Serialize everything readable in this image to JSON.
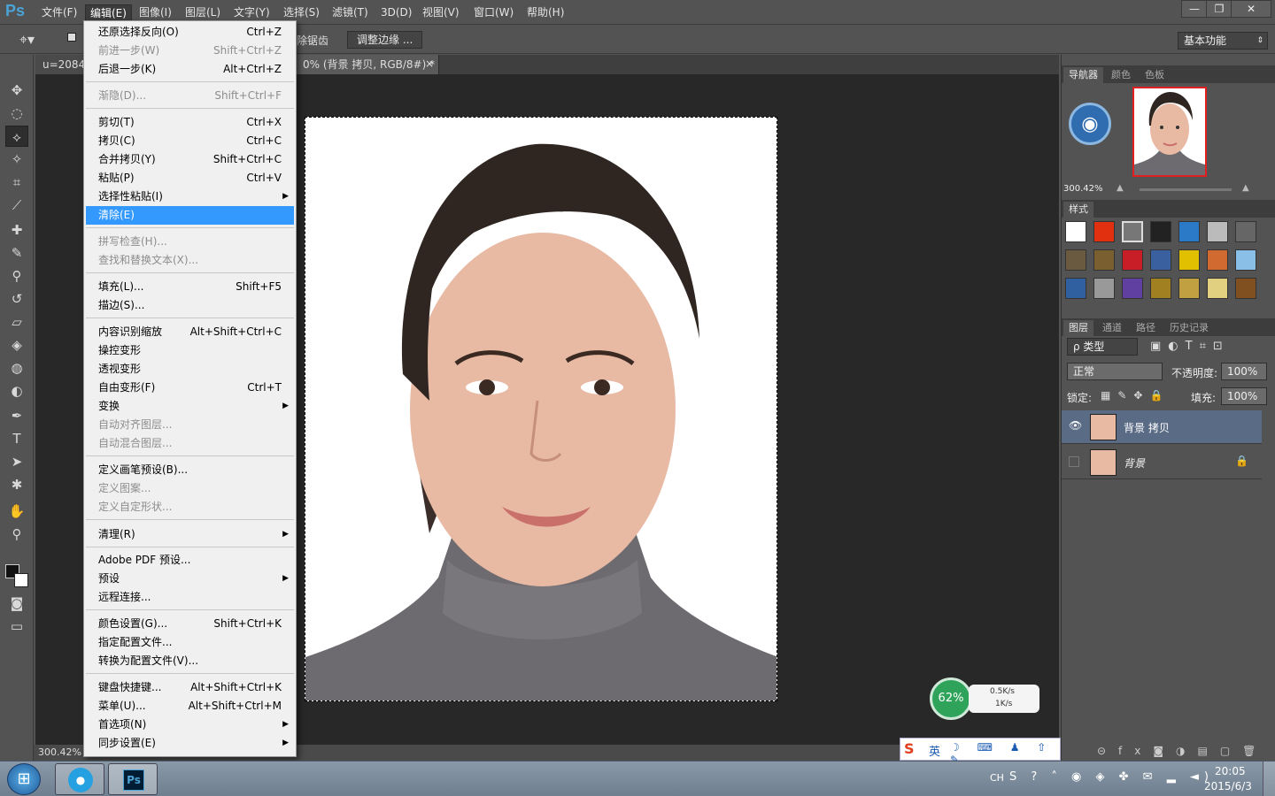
{
  "app": {
    "logo": "Ps",
    "menus": [
      "文件(F)",
      "编辑(E)",
      "图像(I)",
      "图层(L)",
      "文字(Y)",
      "选择(S)",
      "滤镜(T)",
      "3D(D)",
      "视图(V)",
      "窗口(W)",
      "帮助(H)"
    ],
    "window_buttons": [
      "—",
      "❐",
      "✕"
    ]
  },
  "options_bar": {
    "partial_label": "除锯齿",
    "refine_edge_button": "调整边缘 ...",
    "workspace": "基本功能"
  },
  "tabs": {
    "left_tab": "u=2084",
    "doc_tab": "0% (背景 拷贝, RGB/8#) *",
    "close": "×"
  },
  "status": {
    "zoom": "300.42%"
  },
  "edit_menu": {
    "items": [
      {
        "label": "还原选择反向(O)",
        "shortcut": "Ctrl+Z",
        "disabled": false
      },
      {
        "label": "前进一步(W)",
        "shortcut": "Shift+Ctrl+Z",
        "disabled": true
      },
      {
        "label": "后退一步(K)",
        "shortcut": "Alt+Ctrl+Z",
        "disabled": false
      },
      {
        "label": "渐隐(D)...",
        "shortcut": "Shift+Ctrl+F",
        "disabled": true
      },
      {
        "label": "剪切(T)",
        "shortcut": "Ctrl+X",
        "disabled": false
      },
      {
        "label": "拷贝(C)",
        "shortcut": "Ctrl+C",
        "disabled": false
      },
      {
        "label": "合并拷贝(Y)",
        "shortcut": "Shift+Ctrl+C",
        "disabled": false
      },
      {
        "label": "粘贴(P)",
        "shortcut": "Ctrl+V",
        "disabled": false
      },
      {
        "label": "选择性粘贴(I)",
        "shortcut": "",
        "submenu": true,
        "disabled": false
      },
      {
        "label": "清除(E)",
        "shortcut": "",
        "disabled": false,
        "highlighted": true
      },
      {
        "label": "拼写检查(H)...",
        "shortcut": "",
        "disabled": true
      },
      {
        "label": "查找和替换文本(X)...",
        "shortcut": "",
        "disabled": true
      },
      {
        "label": "填充(L)...",
        "shortcut": "Shift+F5",
        "disabled": false
      },
      {
        "label": "描边(S)...",
        "shortcut": "",
        "disabled": false
      },
      {
        "label": "内容识别缩放",
        "shortcut": "Alt+Shift+Ctrl+C",
        "disabled": false
      },
      {
        "label": "操控变形",
        "shortcut": "",
        "disabled": false
      },
      {
        "label": "透视变形",
        "shortcut": "",
        "disabled": false
      },
      {
        "label": "自由变形(F)",
        "shortcut": "Ctrl+T",
        "disabled": false
      },
      {
        "label": "变换",
        "shortcut": "",
        "submenu": true,
        "disabled": false
      },
      {
        "label": "自动对齐图层...",
        "shortcut": "",
        "disabled": true
      },
      {
        "label": "自动混合图层...",
        "shortcut": "",
        "disabled": true
      },
      {
        "label": "定义画笔预设(B)...",
        "shortcut": "",
        "disabled": false
      },
      {
        "label": "定义图案...",
        "shortcut": "",
        "disabled": true
      },
      {
        "label": "定义自定形状...",
        "shortcut": "",
        "disabled": true
      },
      {
        "label": "清理(R)",
        "shortcut": "",
        "submenu": true,
        "disabled": false
      },
      {
        "label": "Adobe PDF 预设...",
        "shortcut": "",
        "disabled": false
      },
      {
        "label": "预设",
        "shortcut": "",
        "submenu": true,
        "disabled": false
      },
      {
        "label": "远程连接...",
        "shortcut": "",
        "disabled": false
      },
      {
        "label": "颜色设置(G)...",
        "shortcut": "Shift+Ctrl+K",
        "disabled": false
      },
      {
        "label": "指定配置文件...",
        "shortcut": "",
        "disabled": false
      },
      {
        "label": "转换为配置文件(V)...",
        "shortcut": "",
        "disabled": false
      },
      {
        "label": "键盘快捷键...",
        "shortcut": "Alt+Shift+Ctrl+K",
        "disabled": false
      },
      {
        "label": "菜单(U)...",
        "shortcut": "Alt+Shift+Ctrl+M",
        "disabled": false
      },
      {
        "label": "首选项(N)",
        "shortcut": "",
        "submenu": true,
        "disabled": false
      },
      {
        "label": "同步设置(E)",
        "shortcut": "",
        "submenu": true,
        "disabled": false
      }
    ]
  },
  "navigator": {
    "tabs": [
      "导航器",
      "颜色",
      "色板"
    ],
    "zoom": "300.42%"
  },
  "styles": {
    "tab": "样式"
  },
  "layers": {
    "tabs": [
      "图层",
      "通道",
      "路径",
      "历史记录"
    ],
    "filter": "ρ 类型",
    "blend_mode": "正常",
    "opacity_label": "不透明度:",
    "opacity": "100%",
    "lock_label": "锁定:",
    "fill_label": "填充:",
    "fill": "100%",
    "rows": [
      {
        "name": "背景 拷贝",
        "visible": true,
        "selected": true,
        "locked": false
      },
      {
        "name": "背景",
        "visible": false,
        "selected": false,
        "locked": true
      }
    ]
  },
  "net_widget": {
    "percent": "62%",
    "up": "0.5K/s",
    "down": "1K/s"
  },
  "ime": {
    "lang": "英"
  },
  "taskbar": {
    "lang": "CH",
    "time": "20:05",
    "date": "2015/6/3"
  },
  "colors": {
    "accent": "#3399ff",
    "panel_bg": "#535353",
    "canvas_bg": "#282828"
  }
}
